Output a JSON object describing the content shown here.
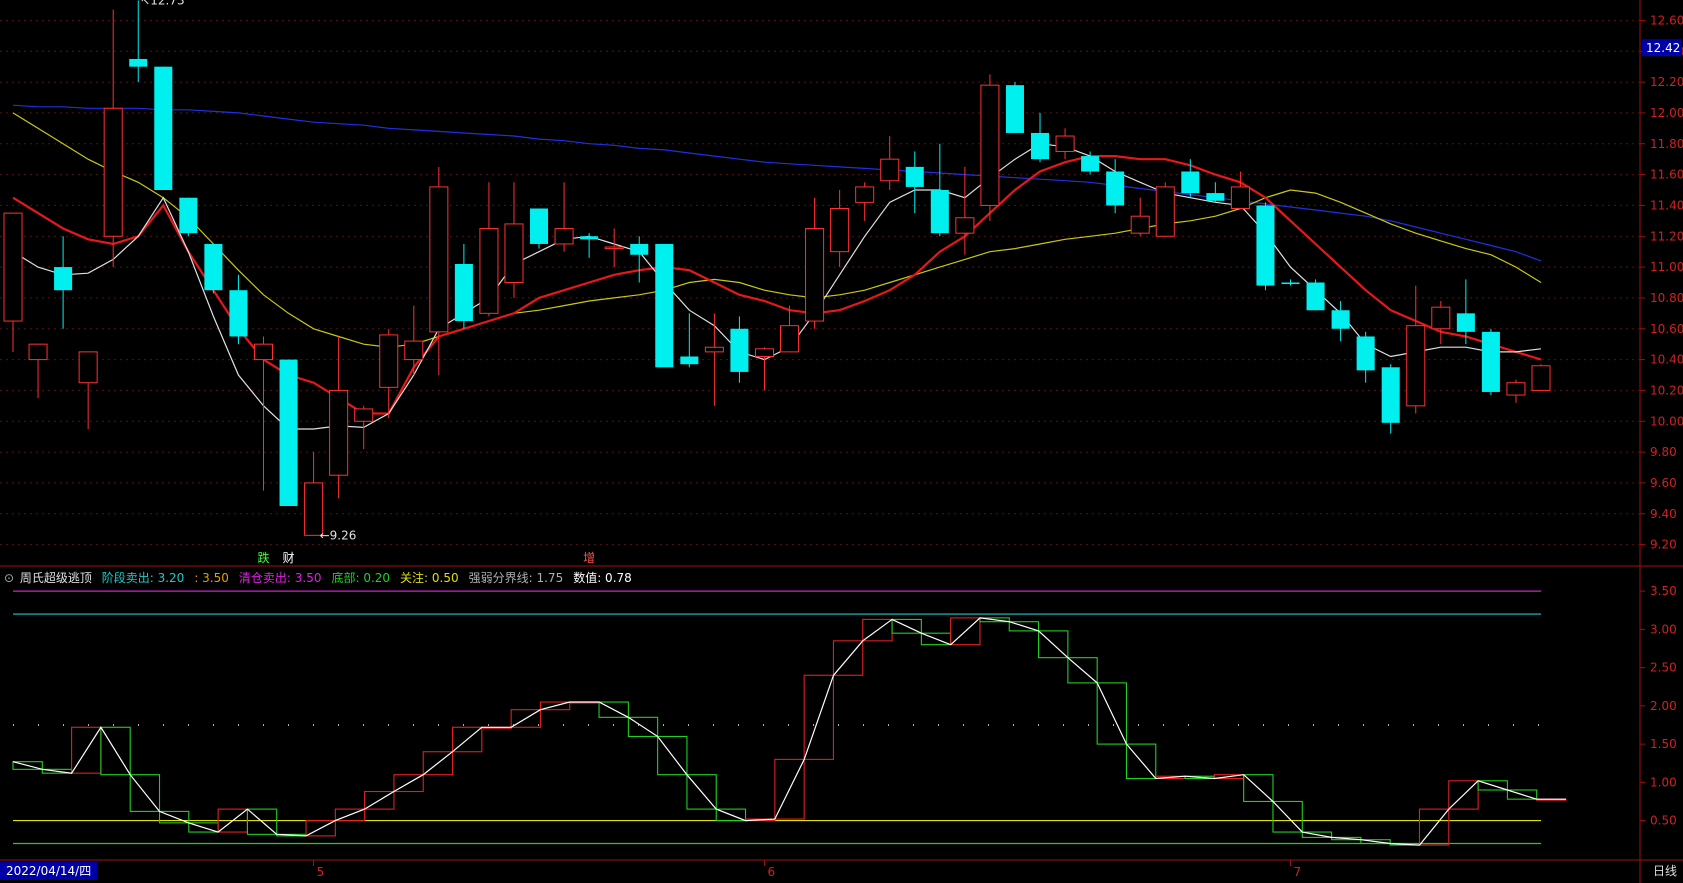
{
  "chart_data": [
    {
      "type": "candlestick",
      "title": "",
      "ylim": [
        9.1,
        12.7
      ],
      "yticks": [
        "12.60",
        "12.40",
        "12.20",
        "12.00",
        "11.80",
        "11.60",
        "11.40",
        "11.20",
        "11.00",
        "10.80",
        "10.60",
        "10.40",
        "10.20",
        "10.00",
        "9.80",
        "9.60",
        "9.40",
        "9.20"
      ],
      "last_price_label": "12.42",
      "high_annotation": "12.73",
      "low_annotation": "9.26",
      "candles": [
        {
          "o": 10.65,
          "h": 11.35,
          "l": 10.45,
          "c": 11.35,
          "up": true
        },
        {
          "o": 10.4,
          "h": 10.5,
          "l": 10.15,
          "c": 10.5,
          "up": true
        },
        {
          "o": 11.0,
          "h": 11.2,
          "l": 10.6,
          "c": 10.85,
          "up": false
        },
        {
          "o": 10.25,
          "h": 10.45,
          "l": 9.95,
          "c": 10.45,
          "up": true
        },
        {
          "o": 11.2,
          "h": 12.67,
          "l": 11.0,
          "c": 12.03,
          "up": true
        },
        {
          "o": 12.35,
          "h": 12.73,
          "l": 12.2,
          "c": 12.3,
          "up": false
        },
        {
          "o": 12.3,
          "h": 12.3,
          "l": 11.5,
          "c": 11.5,
          "up": false
        },
        {
          "o": 11.45,
          "h": 11.45,
          "l": 11.2,
          "c": 11.22,
          "up": false
        },
        {
          "o": 11.15,
          "h": 11.15,
          "l": 10.83,
          "c": 10.85,
          "up": false
        },
        {
          "o": 10.85,
          "h": 10.95,
          "l": 10.5,
          "c": 10.55,
          "up": false
        },
        {
          "o": 10.4,
          "h": 10.55,
          "l": 9.55,
          "c": 10.5,
          "up": true
        },
        {
          "o": 10.4,
          "h": 10.4,
          "l": 9.45,
          "c": 9.45,
          "up": false
        },
        {
          "o": 9.26,
          "h": 9.8,
          "l": 9.26,
          "c": 9.6,
          "up": true
        },
        {
          "o": 9.65,
          "h": 10.55,
          "l": 9.5,
          "c": 10.2,
          "up": true
        },
        {
          "o": 10.0,
          "h": 10.1,
          "l": 9.82,
          "c": 10.08,
          "up": true
        },
        {
          "o": 10.22,
          "h": 10.6,
          "l": 10.02,
          "c": 10.56,
          "up": true
        },
        {
          "o": 10.4,
          "h": 10.75,
          "l": 10.3,
          "c": 10.52,
          "up": true
        },
        {
          "o": 10.58,
          "h": 11.65,
          "l": 10.3,
          "c": 11.52,
          "up": true
        },
        {
          "o": 10.65,
          "h": 11.15,
          "l": 10.6,
          "c": 11.02,
          "up": false
        },
        {
          "o": 10.7,
          "h": 11.55,
          "l": 10.68,
          "c": 11.25,
          "up": true
        },
        {
          "o": 10.9,
          "h": 11.55,
          "l": 10.8,
          "c": 11.28,
          "up": true
        },
        {
          "o": 11.38,
          "h": 11.38,
          "l": 11.12,
          "c": 11.15,
          "up": false
        },
        {
          "o": 11.15,
          "h": 11.55,
          "l": 11.1,
          "c": 11.25,
          "up": true
        },
        {
          "o": 11.2,
          "h": 11.22,
          "l": 11.06,
          "c": 11.18,
          "up": false
        },
        {
          "o": 11.12,
          "h": 11.25,
          "l": 11.0,
          "c": 11.13,
          "up": true
        },
        {
          "o": 11.15,
          "h": 11.2,
          "l": 10.9,
          "c": 11.08,
          "up": false
        },
        {
          "o": 11.15,
          "h": 11.15,
          "l": 10.35,
          "c": 10.35,
          "up": false
        },
        {
          "o": 10.42,
          "h": 10.7,
          "l": 10.35,
          "c": 10.37,
          "up": false
        },
        {
          "o": 10.45,
          "h": 10.7,
          "l": 10.1,
          "c": 10.48,
          "up": true
        },
        {
          "o": 10.6,
          "h": 10.68,
          "l": 10.25,
          "c": 10.32,
          "up": false
        },
        {
          "o": 10.42,
          "h": 10.48,
          "l": 10.2,
          "c": 10.47,
          "up": true
        },
        {
          "o": 10.45,
          "h": 10.75,
          "l": 10.45,
          "c": 10.62,
          "up": true
        },
        {
          "o": 10.65,
          "h": 11.45,
          "l": 10.6,
          "c": 11.25,
          "up": true
        },
        {
          "o": 11.1,
          "h": 11.5,
          "l": 11.0,
          "c": 11.38,
          "up": true
        },
        {
          "o": 11.42,
          "h": 11.55,
          "l": 11.3,
          "c": 11.52,
          "up": true
        },
        {
          "o": 11.7,
          "h": 11.85,
          "l": 11.5,
          "c": 11.56,
          "up": true
        },
        {
          "o": 11.65,
          "h": 11.75,
          "l": 11.35,
          "c": 11.52,
          "up": false
        },
        {
          "o": 11.5,
          "h": 11.8,
          "l": 11.2,
          "c": 11.22,
          "up": false
        },
        {
          "o": 11.22,
          "h": 11.65,
          "l": 11.08,
          "c": 11.32,
          "up": true
        },
        {
          "o": 11.4,
          "h": 12.25,
          "l": 11.3,
          "c": 12.18,
          "up": true
        },
        {
          "o": 12.18,
          "h": 12.2,
          "l": 11.87,
          "c": 11.87,
          "up": false
        },
        {
          "o": 11.87,
          "h": 12.0,
          "l": 11.68,
          "c": 11.7,
          "up": false
        },
        {
          "o": 11.75,
          "h": 11.9,
          "l": 11.7,
          "c": 11.85,
          "up": true
        },
        {
          "o": 11.72,
          "h": 11.75,
          "l": 11.6,
          "c": 11.62,
          "up": false
        },
        {
          "o": 11.62,
          "h": 11.7,
          "l": 11.35,
          "c": 11.4,
          "up": false
        },
        {
          "o": 11.22,
          "h": 11.45,
          "l": 11.2,
          "c": 11.33,
          "up": true
        },
        {
          "o": 11.2,
          "h": 11.55,
          "l": 11.2,
          "c": 11.52,
          "up": true
        },
        {
          "o": 11.62,
          "h": 11.7,
          "l": 11.45,
          "c": 11.48,
          "up": false
        },
        {
          "o": 11.48,
          "h": 11.55,
          "l": 11.42,
          "c": 11.43,
          "up": false
        },
        {
          "o": 11.38,
          "h": 11.62,
          "l": 11.38,
          "c": 11.52,
          "up": true
        },
        {
          "o": 11.4,
          "h": 11.42,
          "l": 10.85,
          "c": 10.88,
          "up": false
        },
        {
          "o": 10.9,
          "h": 10.92,
          "l": 10.88,
          "c": 10.89,
          "up": false
        },
        {
          "o": 10.9,
          "h": 10.92,
          "l": 10.72,
          "c": 10.72,
          "up": false
        },
        {
          "o": 10.72,
          "h": 10.78,
          "l": 10.52,
          "c": 10.6,
          "up": false
        },
        {
          "o": 10.55,
          "h": 10.58,
          "l": 10.25,
          "c": 10.33,
          "up": false
        },
        {
          "o": 10.35,
          "h": 10.37,
          "l": 9.92,
          "c": 9.99,
          "up": false
        },
        {
          "o": 10.1,
          "h": 10.88,
          "l": 10.05,
          "c": 10.62,
          "up": true
        },
        {
          "o": 10.6,
          "h": 10.78,
          "l": 10.5,
          "c": 10.74,
          "up": true
        },
        {
          "o": 10.7,
          "h": 10.92,
          "l": 10.5,
          "c": 10.58,
          "up": false
        },
        {
          "o": 10.58,
          "h": 10.6,
          "l": 10.17,
          "c": 10.19,
          "up": false
        },
        {
          "o": 10.17,
          "h": 10.27,
          "l": 10.12,
          "c": 10.25,
          "up": true
        },
        {
          "o": 10.2,
          "h": 10.37,
          "l": 10.2,
          "c": 10.36,
          "up": true
        }
      ],
      "ma_colors": {
        "ma5": "#e0e0e0",
        "ma10": "#e81818",
        "ma20": "#c8c814",
        "ma60": "#2030e0"
      },
      "ma5": [
        11.1,
        11.0,
        10.95,
        10.96,
        11.05,
        11.2,
        11.45,
        11.1,
        10.68,
        10.3,
        10.1,
        9.95,
        9.95,
        9.97,
        9.96,
        10.05,
        10.3,
        10.6,
        10.7,
        10.8,
        11.02,
        11.1,
        11.18,
        11.2,
        11.15,
        11.1,
        10.9,
        10.72,
        10.62,
        10.45,
        10.4,
        10.48,
        10.7,
        10.95,
        11.2,
        11.42,
        11.5,
        11.5,
        11.45,
        11.58,
        11.7,
        11.8,
        11.78,
        11.72,
        11.62,
        11.55,
        11.48,
        11.45,
        11.42,
        11.4,
        11.22,
        11.0,
        10.85,
        10.7,
        10.5,
        10.42,
        10.45,
        10.48,
        10.48,
        10.45,
        10.45,
        10.47
      ],
      "ma10": [
        11.45,
        11.35,
        11.25,
        11.18,
        11.15,
        11.2,
        11.4,
        11.1,
        10.85,
        10.6,
        10.4,
        10.3,
        10.25,
        10.15,
        10.05,
        10.05,
        10.35,
        10.55,
        10.6,
        10.65,
        10.7,
        10.8,
        10.85,
        10.9,
        10.95,
        10.98,
        11.0,
        10.98,
        10.9,
        10.82,
        10.78,
        10.72,
        10.7,
        10.72,
        10.78,
        10.85,
        10.95,
        11.1,
        11.2,
        11.35,
        11.5,
        11.62,
        11.68,
        11.72,
        11.72,
        11.7,
        11.7,
        11.66,
        11.6,
        11.55,
        11.45,
        11.3,
        11.15,
        11.0,
        10.85,
        10.72,
        10.65,
        10.58,
        10.55,
        10.5,
        10.45,
        10.4
      ],
      "ma20": [
        12.0,
        11.9,
        11.8,
        11.7,
        11.62,
        11.55,
        11.45,
        11.32,
        11.15,
        10.98,
        10.82,
        10.7,
        10.6,
        10.55,
        10.5,
        10.48,
        10.5,
        10.55,
        10.6,
        10.65,
        10.7,
        10.72,
        10.75,
        10.78,
        10.8,
        10.82,
        10.85,
        10.9,
        10.92,
        10.9,
        10.85,
        10.82,
        10.8,
        10.82,
        10.85,
        10.9,
        10.95,
        11.0,
        11.05,
        11.1,
        11.12,
        11.15,
        11.18,
        11.2,
        11.22,
        11.25,
        11.28,
        11.3,
        11.33,
        11.38,
        11.45,
        11.5,
        11.48,
        11.42,
        11.35,
        11.28,
        11.22,
        11.17,
        11.12,
        11.08,
        11.0,
        10.9
      ],
      "ma60": [
        12.05,
        12.04,
        12.04,
        12.03,
        12.03,
        12.03,
        12.02,
        12.02,
        12.01,
        12.0,
        11.98,
        11.96,
        11.94,
        11.93,
        11.92,
        11.9,
        11.89,
        11.88,
        11.87,
        11.86,
        11.85,
        11.83,
        11.82,
        11.8,
        11.79,
        11.77,
        11.76,
        11.74,
        11.72,
        11.7,
        11.68,
        11.67,
        11.66,
        11.65,
        11.64,
        11.63,
        11.62,
        11.61,
        11.6,
        11.59,
        11.58,
        11.57,
        11.56,
        11.55,
        11.53,
        11.51,
        11.49,
        11.47,
        11.45,
        11.43,
        11.41,
        11.39,
        11.37,
        11.35,
        11.33,
        11.3,
        11.26,
        11.22,
        11.18,
        11.14,
        11.1,
        11.04
      ],
      "signals": [
        {
          "index": 10,
          "text": "跌",
          "color": "#40ff40"
        },
        {
          "index": 11,
          "text": "财",
          "color": "#ffffff"
        },
        {
          "index": 23,
          "text": "增",
          "color": "#ff5050"
        }
      ]
    },
    {
      "type": "line",
      "title": "周氏超级逃顶",
      "legend": [
        {
          "label": "阶段卖出:",
          "value": "3.20",
          "color": "#20c8c8"
        },
        {
          "label": ":",
          "value": "3.50",
          "color": "#e0a000"
        },
        {
          "label": "清仓卖出:",
          "value": "3.50",
          "color": "#e020e0"
        },
        {
          "label": "底部:",
          "value": "0.20",
          "color": "#20d020"
        },
        {
          "label": "关注:",
          "value": "0.50",
          "color": "#e0e000"
        },
        {
          "label": "强弱分界线:",
          "value": "1.75",
          "color": "#b0b0b0"
        },
        {
          "label": "数值:",
          "value": "0.78",
          "color": "#ffffff"
        }
      ],
      "ylim": [
        0.05,
        3.75
      ],
      "yticks": [
        "3.50",
        "3.00",
        "2.50",
        "2.00",
        "1.50",
        "1.00",
        "0.50"
      ],
      "hlines": [
        {
          "y": 3.5,
          "color": "#d020d0"
        },
        {
          "y": 3.2,
          "color": "#20c8c8"
        },
        {
          "y": 1.75,
          "color": "#b0b0b0",
          "dotted": true
        },
        {
          "y": 0.5,
          "color": "#e0e000"
        },
        {
          "y": 0.2,
          "color": "#20d020"
        }
      ],
      "values": [
        1.27,
        1.17,
        1.12,
        1.72,
        1.1,
        0.62,
        0.47,
        0.35,
        0.65,
        0.32,
        0.3,
        0.5,
        0.65,
        0.88,
        1.1,
        1.4,
        1.72,
        1.72,
        1.95,
        2.05,
        2.05,
        1.85,
        1.6,
        1.1,
        0.65,
        0.5,
        0.52,
        1.3,
        2.4,
        2.85,
        3.13,
        2.95,
        2.8,
        3.15,
        3.1,
        2.98,
        2.63,
        2.3,
        1.5,
        1.05,
        1.08,
        1.05,
        1.1,
        0.75,
        0.35,
        0.28,
        0.25,
        0.2,
        0.18,
        0.65,
        1.02,
        0.9,
        0.78,
        0.78
      ],
      "colors": {
        "line": "#ffffff",
        "up": "#e02020",
        "down": "#20d020"
      }
    }
  ],
  "footer": {
    "date": "2022/04/14/四",
    "period": "日线"
  },
  "month_marks": [
    {
      "index": 12,
      "label": "5"
    },
    {
      "index": 30,
      "label": "6"
    },
    {
      "index": 51,
      "label": "7"
    }
  ]
}
